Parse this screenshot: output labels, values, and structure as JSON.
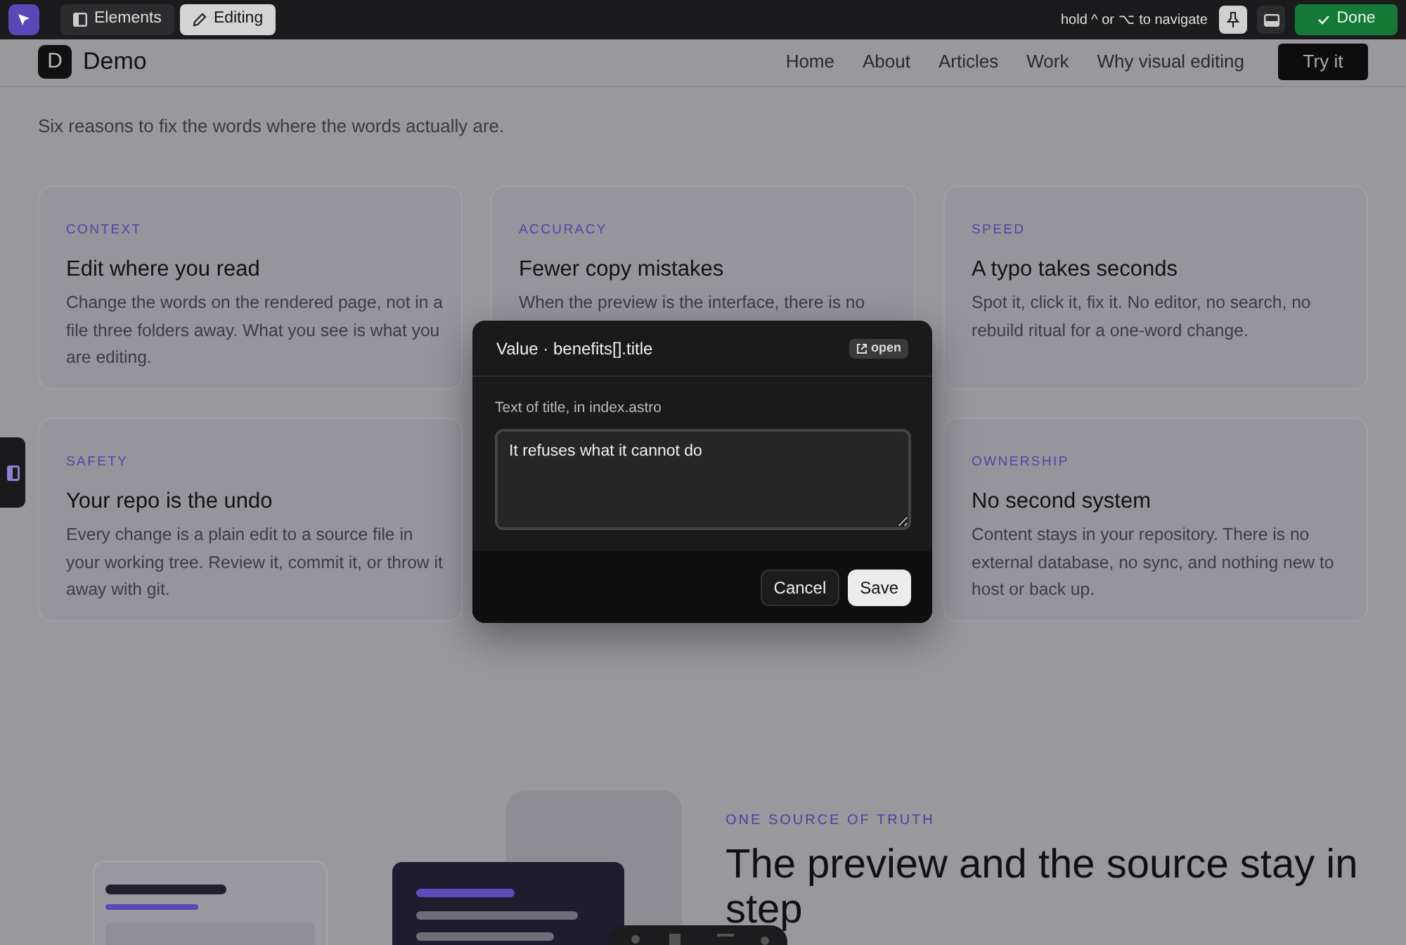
{
  "toolbar": {
    "tabs": [
      {
        "label": "Elements",
        "selected": false
      },
      {
        "label": "Editing",
        "selected": true
      }
    ],
    "hint": "hold ^ or ⌥ to navigate",
    "pinned": true,
    "done": "Done"
  },
  "site_nav": {
    "logo": "D",
    "brand": "Demo",
    "links": [
      "Home",
      "About",
      "Articles",
      "Work",
      "Why visual editing"
    ],
    "cta": "Try it"
  },
  "intro": "Six reasons to fix the words where the words actually are.",
  "benefits": [
    {
      "label": "CONTEXT",
      "title": "Edit where you read",
      "body": "Change the words on the rendered page, not in a file three folders away. What you see is what you are editing."
    },
    {
      "label": "ACCURACY",
      "title": "Fewer copy mistakes",
      "body": "When the preview is the interface, there is no"
    },
    {
      "label": "SPEED",
      "title": "A typo takes seconds",
      "body": "Spot it, click it, fix it. No editor, no search, no rebuild ritual for a one-word change."
    },
    {
      "label": "SAFETY",
      "title": "Your repo is the undo",
      "body": "Every change is a plain edit to a source file in your working tree. Review it, commit it, or throw it away with git."
    },
    {
      "label": "OWNERSHIP",
      "title": "No second system",
      "body": "Content stays in your repository. There is no external database, no sync, and nothing new to host or back up."
    }
  ],
  "modal": {
    "title": "Value · benefits[].title",
    "open": "open",
    "field_label": "Text of title, in index.astro",
    "value": "It refuses what it cannot do",
    "cancel": "Cancel",
    "save": "Save"
  },
  "section": {
    "eyebrow": "ONE SOURCE OF TRUTH",
    "heading": "The preview and the source stay in step"
  }
}
